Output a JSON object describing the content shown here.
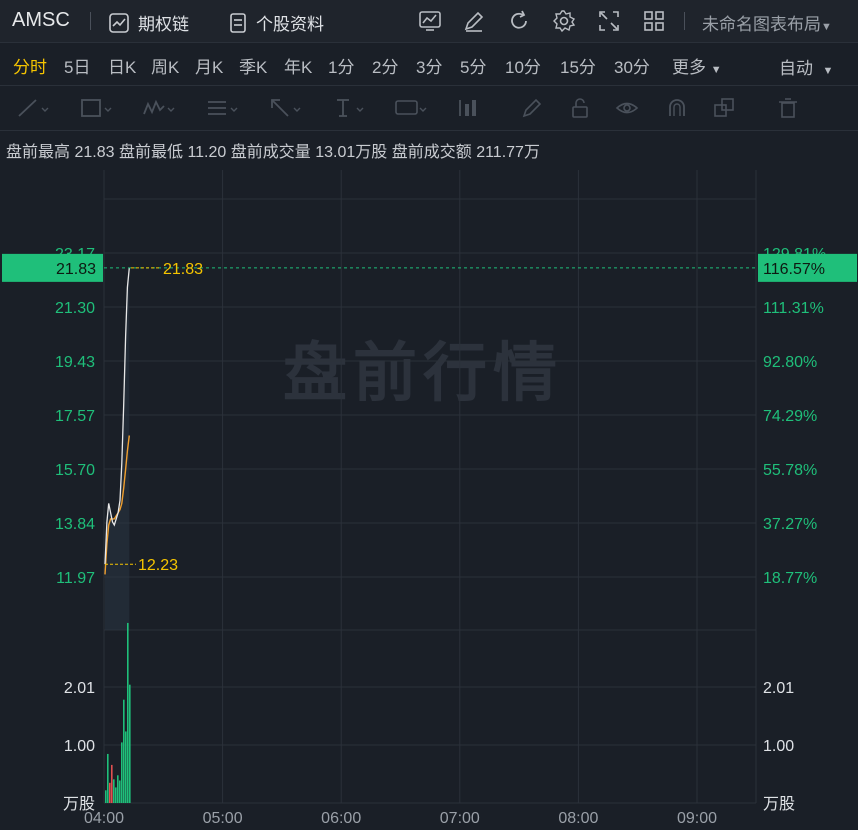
{
  "topbar": {
    "ticker": "AMSC",
    "options_chain": "期权链",
    "stock_profile": "个股资料",
    "layout_name": "未命名图表布局",
    "icons": [
      "indicator-icon",
      "draw-icon",
      "refresh-icon",
      "settings-icon",
      "fullscreen-icon",
      "layout-grid-icon"
    ]
  },
  "periods": {
    "items": [
      "分时",
      "5日",
      "日K",
      "周K",
      "月K",
      "季K",
      "年K",
      "1分",
      "2分",
      "3分",
      "5分",
      "10分",
      "15分",
      "30分",
      "更多"
    ],
    "active": "分时",
    "auto_label": "自动"
  },
  "info": {
    "high_label": "盘前最高",
    "high_value": "21.83",
    "low_label": "盘前最低",
    "low_value": "11.20",
    "volume_label": "盘前成交量",
    "volume_value": "13.01万股",
    "turnover_label": "盘前成交额",
    "turnover_value": "211.77万"
  },
  "watermark": "盘前行情",
  "colors": {
    "up": "#1fbf7a",
    "down": "#e05050",
    "price_line": "#e8e8e8",
    "avg_line": "#f0a030",
    "badge": "#1fbf7a",
    "label_yellow": "#f5c400"
  },
  "chart_data": {
    "type": "line",
    "x_ticks": [
      "04:00",
      "05:00",
      "06:00",
      "07:00",
      "08:00",
      "09:00"
    ],
    "price_ticks_left": [
      "23.17",
      "21.30",
      "19.43",
      "17.57",
      "15.70",
      "13.84",
      "11.97"
    ],
    "price_ticks_right": [
      "129.81%",
      "111.31%",
      "92.80%",
      "74.29%",
      "55.78%",
      "37.27%",
      "18.77%"
    ],
    "current_price": "21.83",
    "current_pct": "116.57%",
    "high_label": "21.83",
    "low_label": "12.23",
    "ylim": [
      10.1,
      25.0
    ],
    "price_series": {
      "name": "price",
      "x_minutes": [
        0,
        1,
        2,
        3,
        4,
        5,
        6,
        7,
        8,
        9,
        10,
        11,
        12,
        13
      ],
      "values": [
        12.23,
        13.6,
        14.2,
        13.9,
        13.6,
        13.5,
        13.7,
        13.9,
        14.3,
        15.5,
        17.4,
        19.6,
        21.2,
        21.83
      ]
    },
    "avg_series": {
      "name": "avg",
      "x_minutes": [
        0,
        1,
        2,
        3,
        4,
        5,
        6,
        7,
        8,
        9,
        10,
        11,
        12,
        13
      ],
      "values": [
        11.9,
        12.9,
        13.5,
        13.7,
        13.7,
        13.7,
        13.8,
        13.9,
        14.0,
        14.2,
        14.7,
        15.3,
        15.9,
        16.4
      ]
    },
    "volume": {
      "unit": "万股",
      "ticks": [
        "2.01",
        "1.00"
      ],
      "ylim": [
        0,
        3.0
      ],
      "bars": [
        0.22,
        0.85,
        0.35,
        0.66,
        0.41,
        0.27,
        0.48,
        0.39,
        1.05,
        1.79,
        1.24,
        3.12,
        2.05
      ],
      "bar_colors": [
        "up",
        "up",
        "down",
        "down",
        "up",
        "up",
        "up",
        "up",
        "up",
        "up",
        "up",
        "up",
        "up"
      ]
    }
  }
}
